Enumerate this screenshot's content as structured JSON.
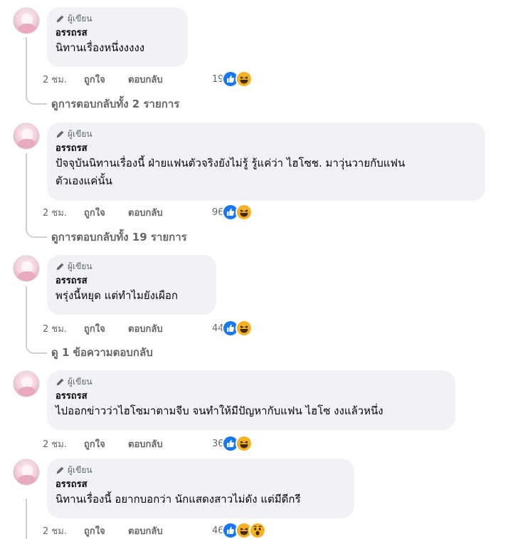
{
  "badge_label": "ผู้เขียน",
  "author_name": "อรรถรส",
  "actions": {
    "like": "ถูกใจ",
    "reply": "ตอบกลับ"
  },
  "reaction_types": [
    "like-icon",
    "haha-icon",
    "wow-icon"
  ],
  "comments": [
    {
      "lines": [
        "นิทานเรื่องหนึ่งงงงง"
      ],
      "time": "2 ชม.",
      "reaction_count": "19",
      "reactions": [
        "like",
        "haha"
      ],
      "view_replies": "ดูการตอบกลับทั้ง 2 รายการ"
    },
    {
      "lines": [
        "ปัจจุบันนิทานเรื่องนี้ ฝ่ายแฟนตัวจริงยังไม่รู้ รู้แค่ว่า ไฮโซช. มาวุ่นวายกับแฟน",
        "ตัวเองแค่นั้น"
      ],
      "time": "2 ชม.",
      "reaction_count": "96",
      "reactions": [
        "like",
        "haha"
      ],
      "view_replies": "ดูการตอบกลับทั้ง 19 รายการ"
    },
    {
      "lines": [
        "พรุ่งนี้หยุด แต่ทำไมยังเผือก"
      ],
      "time": "2 ชม.",
      "reaction_count": "44",
      "reactions": [
        "like",
        "haha"
      ],
      "view_replies": "ดู 1 ข้อความตอบกลับ"
    },
    {
      "lines": [
        "ไปออกข่าวว่าไฮโซมาตามจีบ จนทำให้มีปัญหากับแฟน ไฮโซ งงแล้วหนึ่ง"
      ],
      "time": "2 ชม.",
      "reaction_count": "36",
      "reactions": [
        "like",
        "haha"
      ]
    },
    {
      "lines": [
        "นิทานเรื่องนี้ อยากบอกว่า นักแสดงสาวไม่ดัง แต่มีดีกรี"
      ],
      "time": "2 ชม.",
      "reaction_count": "46",
      "reactions": [
        "like",
        "haha",
        "wow"
      ]
    }
  ],
  "colors": {
    "bubble": "#f0f2f5",
    "secondary_text": "#65676b",
    "like_blue": "#1877f2",
    "haha_yellow": "#f7b125",
    "thread_line": "#ced0d4"
  }
}
